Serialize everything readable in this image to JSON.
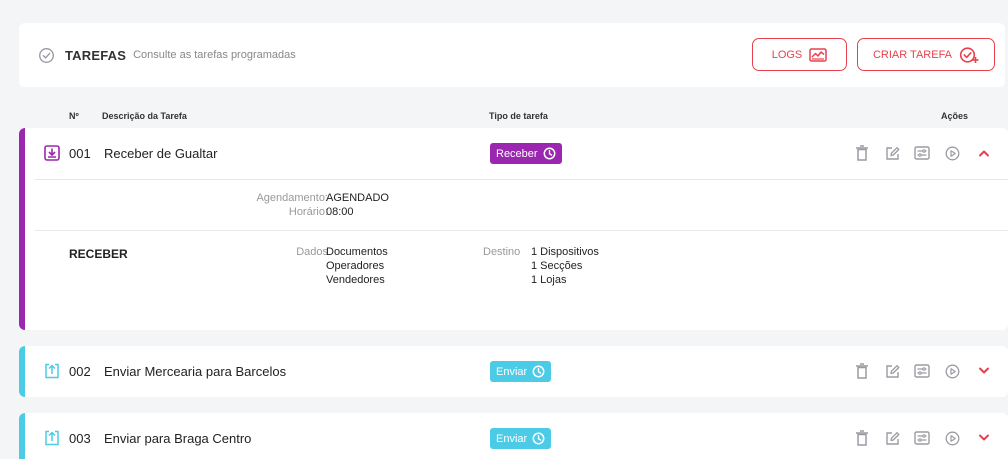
{
  "header": {
    "title": "TAREFAS",
    "subtitle": "Consulte as tarefas programadas",
    "logs_label": "LOGS",
    "criar_label": "CRIAR TAREFA"
  },
  "columns": {
    "num": "Nº",
    "desc": "Descrição da Tarefa",
    "tipo": "Tipo de tarefa",
    "acoes": "Ações"
  },
  "tasks": [
    {
      "num": "001",
      "desc": "Receber de Gualtar",
      "type_label": "Receber",
      "details": {
        "agendamento_label": "Agendamento:",
        "agendamento_value": "AGENDADO",
        "horario_label": "Horário:",
        "horario_value": "08:00",
        "section": "RECEBER",
        "dados_label": "Dados",
        "dados": [
          "Documentos",
          "Operadores",
          "Vendedores"
        ],
        "destino_label": "Destino",
        "destino": [
          "1 Dispositivos",
          "1 Secções",
          "1 Lojas"
        ]
      }
    },
    {
      "num": "002",
      "desc": "Enviar Mercearia para Barcelos",
      "type_label": "Enviar"
    },
    {
      "num": "003",
      "desc": "Enviar para Braga Centro",
      "type_label": "Enviar"
    }
  ],
  "colors": {
    "accent": "#e8414e",
    "receber": "#9b27b0",
    "enviar": "#4ccbe6",
    "icon_gray": "#9a9aa2"
  }
}
